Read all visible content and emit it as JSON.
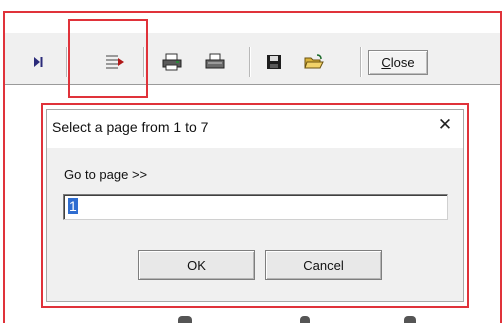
{
  "toolbar": {
    "icons": [
      "last-page-icon",
      "go-to-page-icon",
      "print-setup-icon",
      "print-icon",
      "save-icon",
      "open-folder-icon"
    ],
    "close_label_underlined": "C",
    "close_label_rest": "lose"
  },
  "dialog": {
    "title": "Select a page from 1 to 7",
    "close_glyph": "✕",
    "label": "Go to page >>",
    "input_value": "1",
    "ok_label": "OK",
    "cancel_label": "Cancel"
  },
  "colors": {
    "highlight": "#e0323a",
    "toolbar_bg": "#f0f0f0",
    "dialog_bg": "#f0f0f0",
    "selection": "#2f6dd0"
  }
}
